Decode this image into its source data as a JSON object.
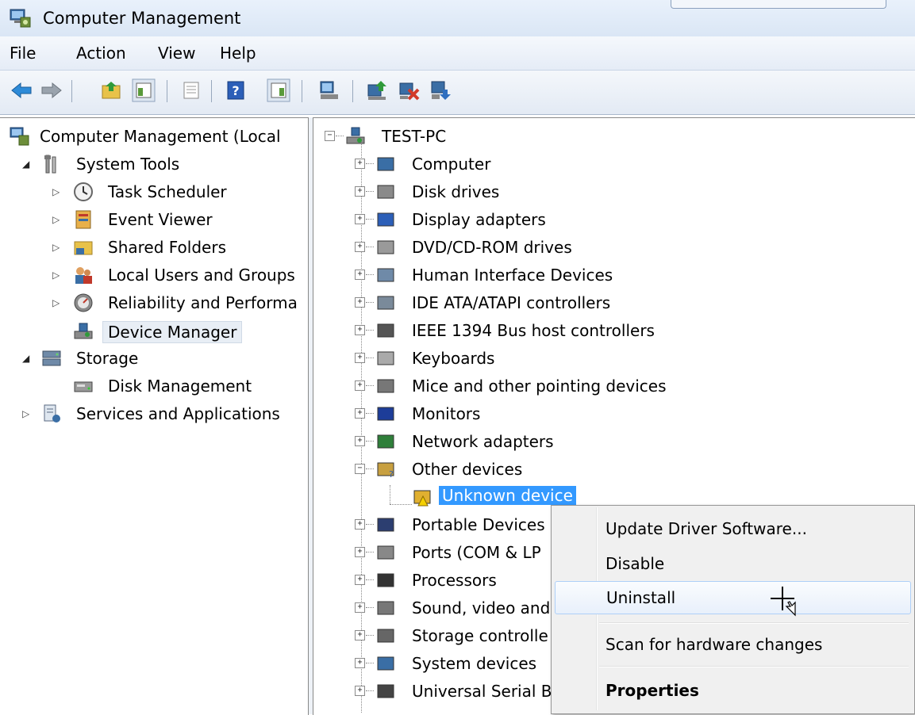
{
  "window": {
    "title": "Computer Management"
  },
  "menu": [
    "File",
    "Action",
    "View",
    "Help"
  ],
  "toolbar": {
    "icons": [
      "back-arrow-icon",
      "forward-arrow-icon",
      "up-folder-icon",
      "show-hide-tree-icon",
      "properties-icon",
      "help-icon",
      "show-hide-action-pane-icon",
      "device-scan-icon",
      "update-driver-icon",
      "disable-device-icon",
      "uninstall-device-icon"
    ]
  },
  "left_tree": {
    "root": "Computer Management (Local",
    "system_tools": "System Tools",
    "task_scheduler": "Task Scheduler",
    "event_viewer": "Event Viewer",
    "shared_folders": "Shared Folders",
    "local_users": "Local Users and Groups",
    "reliability": "Reliability and Performa",
    "device_manager": "Device Manager",
    "storage": "Storage",
    "disk_management": "Disk Management",
    "services": "Services and Applications"
  },
  "device_tree": {
    "root": "TEST-PC",
    "categories": [
      "Computer",
      "Disk drives",
      "Display adapters",
      "DVD/CD-ROM drives",
      "Human Interface Devices",
      "IDE ATA/ATAPI controllers",
      "IEEE 1394 Bus host controllers",
      "Keyboards",
      "Mice and other pointing devices",
      "Monitors",
      "Network adapters",
      "Other devices",
      "Unknown device",
      "Portable Devices",
      "Ports (COM & LP",
      "Processors",
      "Sound, video and",
      "Storage controlle",
      "System devices",
      "Universal Serial B"
    ]
  },
  "context_menu": {
    "items": [
      "Update Driver Software...",
      "Disable",
      "Uninstall",
      "Scan for hardware changes",
      "Properties"
    ],
    "hovered": "Uninstall"
  },
  "colors": {
    "selection": "#3399ff",
    "menu_bg": "#f0f0f0"
  }
}
